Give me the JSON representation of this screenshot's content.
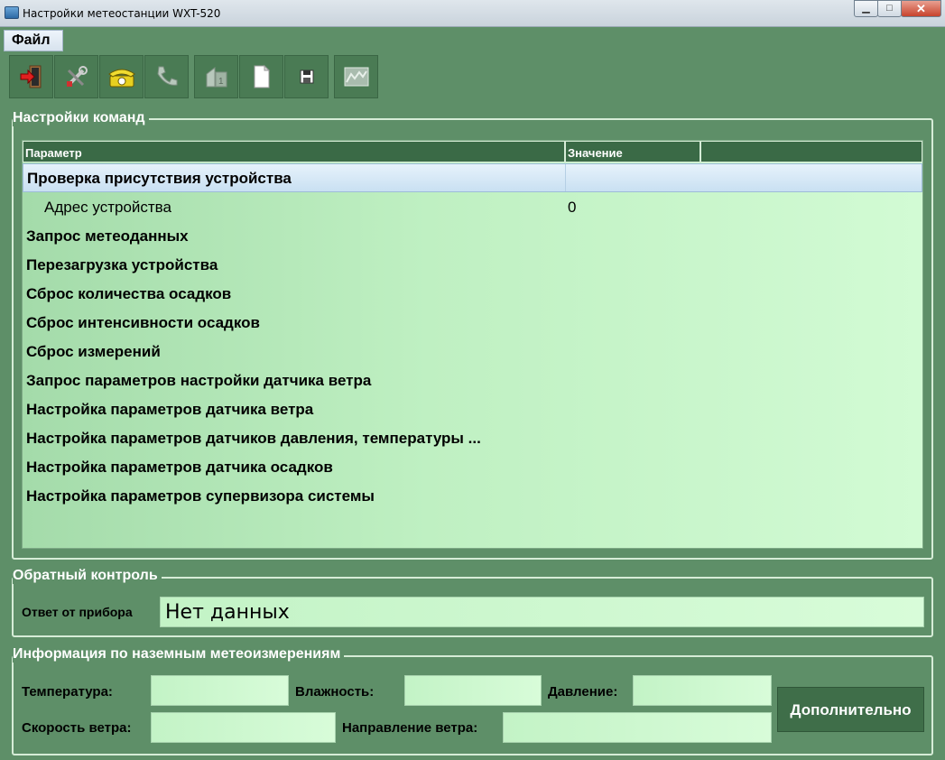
{
  "window": {
    "title": "Настройки метеостанции WXT-520",
    "minimize": "▁",
    "maximize": "□",
    "close": "✕"
  },
  "menu": {
    "file": "Файл"
  },
  "toolbar": {
    "buttons": [
      {
        "icon": "exit-icon"
      },
      {
        "icon": "tools-icon"
      },
      {
        "icon": "phone-icon"
      },
      {
        "icon": "hangup-icon"
      },
      {
        "icon": "station-icon"
      },
      {
        "icon": "new-document-icon"
      },
      {
        "icon": "save-icon"
      },
      {
        "icon": "chart-icon"
      }
    ]
  },
  "commands": {
    "title": "Настройки команд",
    "columns": [
      "Параметр",
      "Значение",
      ""
    ],
    "rows": [
      {
        "label": "Проверка присутствия устройства",
        "value": ""
      },
      {
        "label": "Адрес устройства",
        "value": "0"
      },
      {
        "label": "Запрос метеоданных",
        "value": ""
      },
      {
        "label": "Перезагрузка устройства",
        "value": ""
      },
      {
        "label": "Сброс количества осадков",
        "value": ""
      },
      {
        "label": "Сброс интенсивности осадков",
        "value": ""
      },
      {
        "label": "Сброс измерений",
        "value": ""
      },
      {
        "label": "Запрос параметров настройки датчика ветра",
        "value": ""
      },
      {
        "label": "Настройка параметров датчика ветра",
        "value": ""
      },
      {
        "label": "Настройка параметров датчиков давления, температуры ...",
        "value": ""
      },
      {
        "label": "Настройка параметров датчика осадков",
        "value": ""
      },
      {
        "label": "Настройка параметров супервизора системы",
        "value": ""
      }
    ]
  },
  "feedback": {
    "title": "Обратный контроль",
    "response_label": "Ответ от прибора",
    "response_value": "Нет данных"
  },
  "ground": {
    "title": "Информация по наземным метеоизмерениям",
    "temperature_label": "Температура:",
    "humidity_label": "Влажность:",
    "pressure_label": "Давление:",
    "wind_speed_label": "Скорость ветра:",
    "wind_direction_label": "Направление ветра:",
    "more_button": "Дополнительно"
  },
  "colors": {
    "background": "#5e8f68",
    "grid_header": "#3a6a46",
    "field": "#c3f3c6",
    "button": "#3f6e49"
  }
}
